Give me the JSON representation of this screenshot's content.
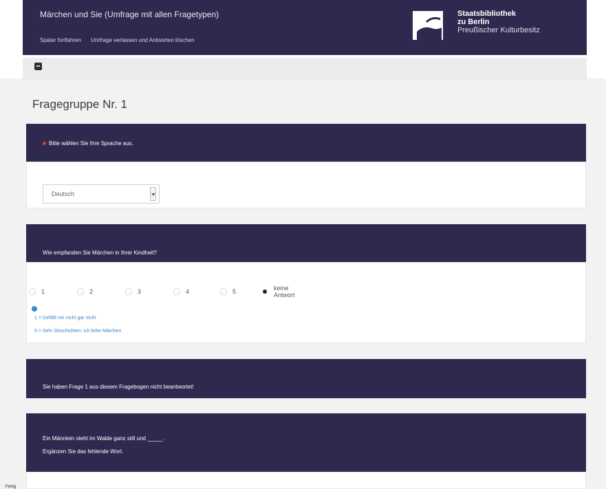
{
  "header": {
    "title": "Märchen und Sie (Umfrage mit allen Fragetypen)",
    "nav": [
      {
        "label": "Später fortfahren"
      },
      {
        "label": "Umfrage verlassen und Antworten löschen"
      }
    ],
    "logo": {
      "line1": "Staatsbibliothek",
      "line2": "zu Berlin",
      "line3": "Preußischer Kulturbesitz"
    }
  },
  "page": {
    "group_title": "Fragegruppe Nr. 1"
  },
  "questions": [
    {
      "text": "Bitte wählen Sie Ihre Sprache aus.",
      "required": true,
      "select_value": "Deutsch"
    },
    {
      "text": "Wie empfanden Sie Märchen in Ihrer Kindheit?",
      "options": [
        "1",
        "2",
        "3",
        "4",
        "5",
        "keine Antwort"
      ],
      "selected_index": 5,
      "legend": [
        "1 = Gefällt mir nicht gar nicht",
        "5 = Sehr Geschichten: ich liebe Märchen"
      ]
    },
    {
      "text": "Sie haben Frage 1 aus diesem Fragebogen nicht beantwortet!"
    },
    {
      "line1": "Ein Männlein steht im Walde ganz still und _____.",
      "line2": "Ergänzen Sie das fehlende Wort."
    }
  ],
  "status": {
    "text": "Fertig"
  },
  "colors": {
    "brand": "#2e2a4f",
    "accent": "#3f86c6",
    "required": "#e53935"
  }
}
